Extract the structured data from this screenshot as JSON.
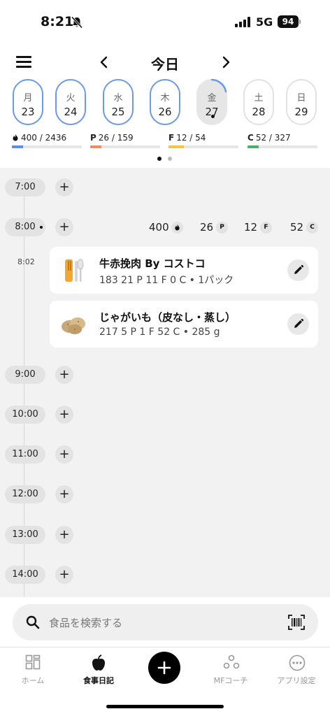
{
  "status": {
    "time": "8:21",
    "network": "5G",
    "battery": "94"
  },
  "header": {
    "title": "今日"
  },
  "days": [
    {
      "weekday": "月",
      "date": "23"
    },
    {
      "weekday": "火",
      "date": "24"
    },
    {
      "weekday": "水",
      "date": "25"
    },
    {
      "weekday": "木",
      "date": "26"
    },
    {
      "weekday": "金",
      "date": "27"
    },
    {
      "weekday": "土",
      "date": "28"
    },
    {
      "weekday": "日",
      "date": "29"
    }
  ],
  "macros": {
    "cal": {
      "text": "400 / 2436",
      "progress": 0.164,
      "color": "#5b8def"
    },
    "p": {
      "letter": "P",
      "text": "26 / 159",
      "progress": 0.164,
      "color": "#f08a64"
    },
    "f": {
      "letter": "F",
      "text": "12 / 54",
      "progress": 0.22,
      "color": "#f5c542"
    },
    "c": {
      "letter": "C",
      "text": "52 / 327",
      "progress": 0.159,
      "color": "#4caf6e"
    }
  },
  "timeline": {
    "hours": [
      "7:00",
      "8:00",
      "9:00",
      "10:00",
      "11:00",
      "12:00",
      "13:00",
      "14:00"
    ],
    "totals": {
      "cal": "400",
      "p": "26",
      "f": "12",
      "c": "52",
      "p_letter": "P",
      "f_letter": "F",
      "c_letter": "C"
    },
    "meal_time": "8:02",
    "entries": [
      {
        "name": "牛赤挽肉 By コストコ",
        "detail": "183 21 P 11 F 0 C • 1パック"
      },
      {
        "name": "じゃがいも（皮なし・蒸し）",
        "detail": "217 5 P 1 F 52 C • 285 g"
      }
    ]
  },
  "search": {
    "placeholder": "食品を検索する"
  },
  "tabs": [
    {
      "label": "ホーム"
    },
    {
      "label": "食事日記"
    },
    {
      "label": "MFコーチ"
    },
    {
      "label": "アプリ設定"
    }
  ]
}
